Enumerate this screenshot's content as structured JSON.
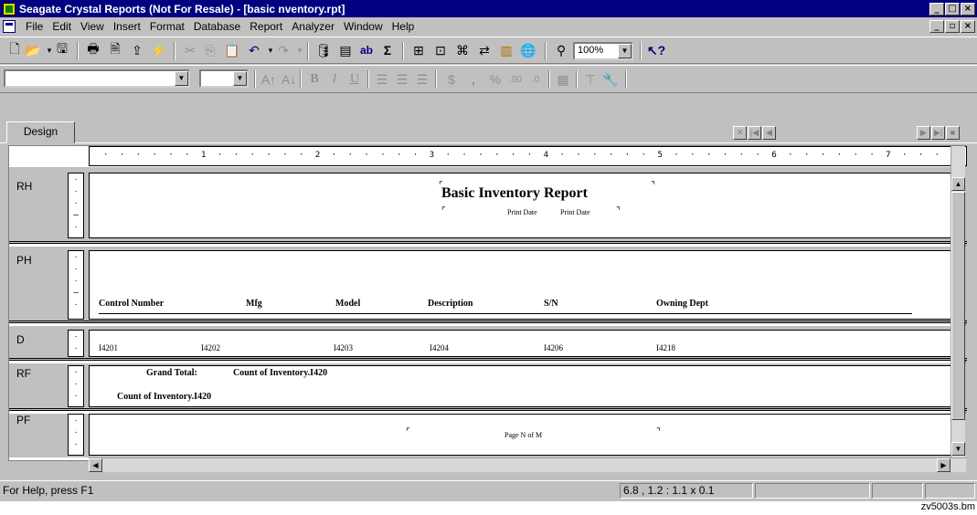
{
  "app": {
    "title": "Seagate Crystal Reports (Not For Resale) - [basic nventory.rpt]",
    "window_buttons": [
      "_",
      "□",
      "×"
    ],
    "doc_buttons": [
      "_",
      "▫",
      "×"
    ]
  },
  "menu": {
    "items": [
      "File",
      "Edit",
      "View",
      "Insert",
      "Format",
      "Database",
      "Report",
      "Analyzer",
      "Window",
      "Help"
    ]
  },
  "toolbar": {
    "zoom": "100%",
    "font_name": "",
    "font_size": ""
  },
  "tabs": {
    "design": "Design"
  },
  "ruler": {
    "marks": "· · · · · · 1 · · · · · · 2 · · · · · · 3 · · · · · · 4 · · · · · · 5 · · · · · · 6 · · · · · · 7 · · · · · · 8 · ·"
  },
  "sections": {
    "rh": "RH",
    "ph": "PH",
    "d": "D",
    "rf": "RF",
    "pf": "PF"
  },
  "report": {
    "title": "Basic Inventory Report",
    "print_date_label": "Print Date",
    "print_date_field": "Print Date",
    "headers": [
      "Control Number",
      "Mfg",
      "Model",
      "Description",
      "S/N",
      "Owning Dept"
    ],
    "detail_fields": [
      "I4201",
      "I4202",
      "I4203",
      "I4204",
      "I4206",
      "I4218"
    ],
    "grand_total_label": "Grand Total:",
    "grand_total_field": "Count of Inventory.I420",
    "count_field": "Count of Inventory.I420",
    "page_n_of_m": "Page N of M"
  },
  "status": {
    "help": "For Help, press F1",
    "position": "6.8 , 1.2 : 1.1 x 0.1"
  },
  "caption": "zv5003s.bm"
}
